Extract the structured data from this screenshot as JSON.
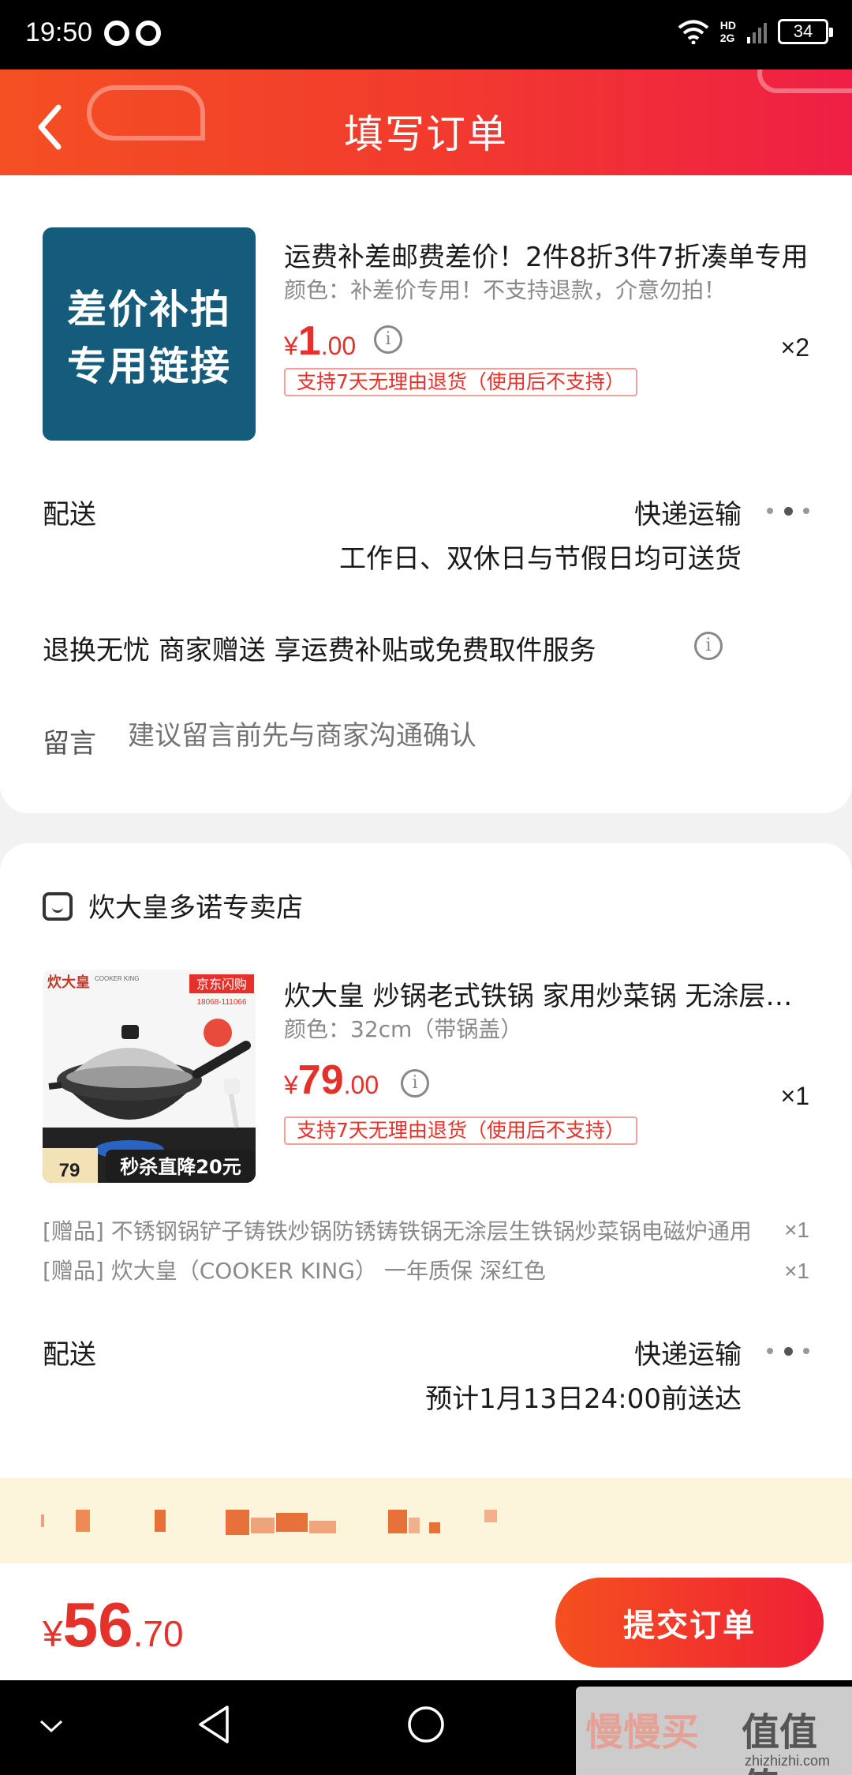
{
  "status_bar": {
    "time": "19:50",
    "network": "HD 2G",
    "battery": "34"
  },
  "header": {
    "title": "填写订单"
  },
  "item1": {
    "thumb_text": [
      "差价补拍",
      "专用链接"
    ],
    "name": "运费补差邮费差价！2件8折3件7折凑单专用",
    "spec": "颜色：补差价专用！不支持退款，介意勿拍！",
    "price": {
      "symbol": "¥",
      "int": "1",
      "dec": ".00"
    },
    "qty": "×2",
    "return_tag": "支持7天无理由退货（使用后不支持）",
    "delivery_label": "配送",
    "delivery_method": "快递运输",
    "delivery_note": "工作日、双休日与节假日均可送货",
    "service": "退换无忧 商家赠送 享运费补贴或免费取件服务",
    "remark_label": "留言",
    "remark_placeholder": "建议留言前先与商家沟通确认"
  },
  "store": {
    "name": "炊大皇多诺专卖店"
  },
  "item2": {
    "thumb": {
      "brand": "炊大皇",
      "brand_en": "COOKER KING",
      "badge": "京东闪购",
      "phone": "18068-111066",
      "promo": "秒杀直降20元",
      "price_small": "79"
    },
    "name": "炊大皇 炒锅老式铁锅 家用炒菜锅 无涂层铁锅",
    "spec": "颜色：32cm（带锅盖）",
    "price": {
      "symbol": "¥",
      "int": "79",
      "dec": ".00"
    },
    "qty": "×1",
    "return_tag": "支持7天无理由退货（使用后不支持）",
    "gifts": [
      {
        "text": "[赠品]  不锈钢锅铲子铸铁炒锅防锈铸铁锅无涂层生铁锅炒菜锅电磁炉通用",
        "qty": "×1"
      },
      {
        "text": "[赠品]  炊大皇（COOKER KING） 一年质保 深红色",
        "qty": "×1"
      }
    ],
    "delivery_label": "配送",
    "delivery_method": "快递运输",
    "delivery_note": "预计1月13日24:00前送达"
  },
  "footer": {
    "symbol": "¥",
    "total_int": "56",
    "total_dec": ".70",
    "submit_label": "提交订单"
  },
  "watermark": {
    "left": "慢慢买",
    "right": "值值值",
    "url": "zhizhizhi.com"
  },
  "colors": {
    "accent": "#e4322b",
    "header_start": "#f44f23",
    "header_end": "#ef1f45",
    "thumb_bg": "#155b7c"
  }
}
